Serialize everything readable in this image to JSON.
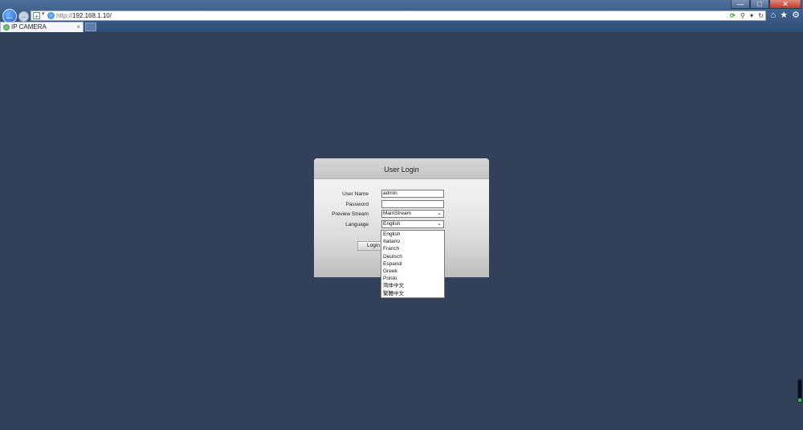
{
  "browser": {
    "url_prefix": "http://",
    "url_host": "192.168.1.10/",
    "tab_title": "IP CAMERA",
    "tab_close": "×",
    "window_buttons": {
      "minimize": "—",
      "maximize": "□",
      "close": "✕"
    },
    "toolbar_icons": [
      "home-icon",
      "star-icon",
      "gear-icon"
    ]
  },
  "login": {
    "title": "User Login",
    "fields": {
      "username": {
        "label": "User Name",
        "value": "admin"
      },
      "password": {
        "label": "Password",
        "value": ""
      },
      "preview_stream": {
        "label": "Preview Stream",
        "value": "MainStream"
      },
      "language": {
        "label": "Language",
        "value": "English"
      }
    },
    "login_button": "Login",
    "language_options": [
      "English",
      "Italiano",
      "Franch",
      "Deutsch",
      "Espanol",
      "Greek",
      "Polski",
      "简体中文",
      "繁體中文"
    ]
  },
  "colors": {
    "page_background": "#33405a",
    "chrome_blue": "#3a5b86",
    "panel_header": "#cccccc"
  }
}
